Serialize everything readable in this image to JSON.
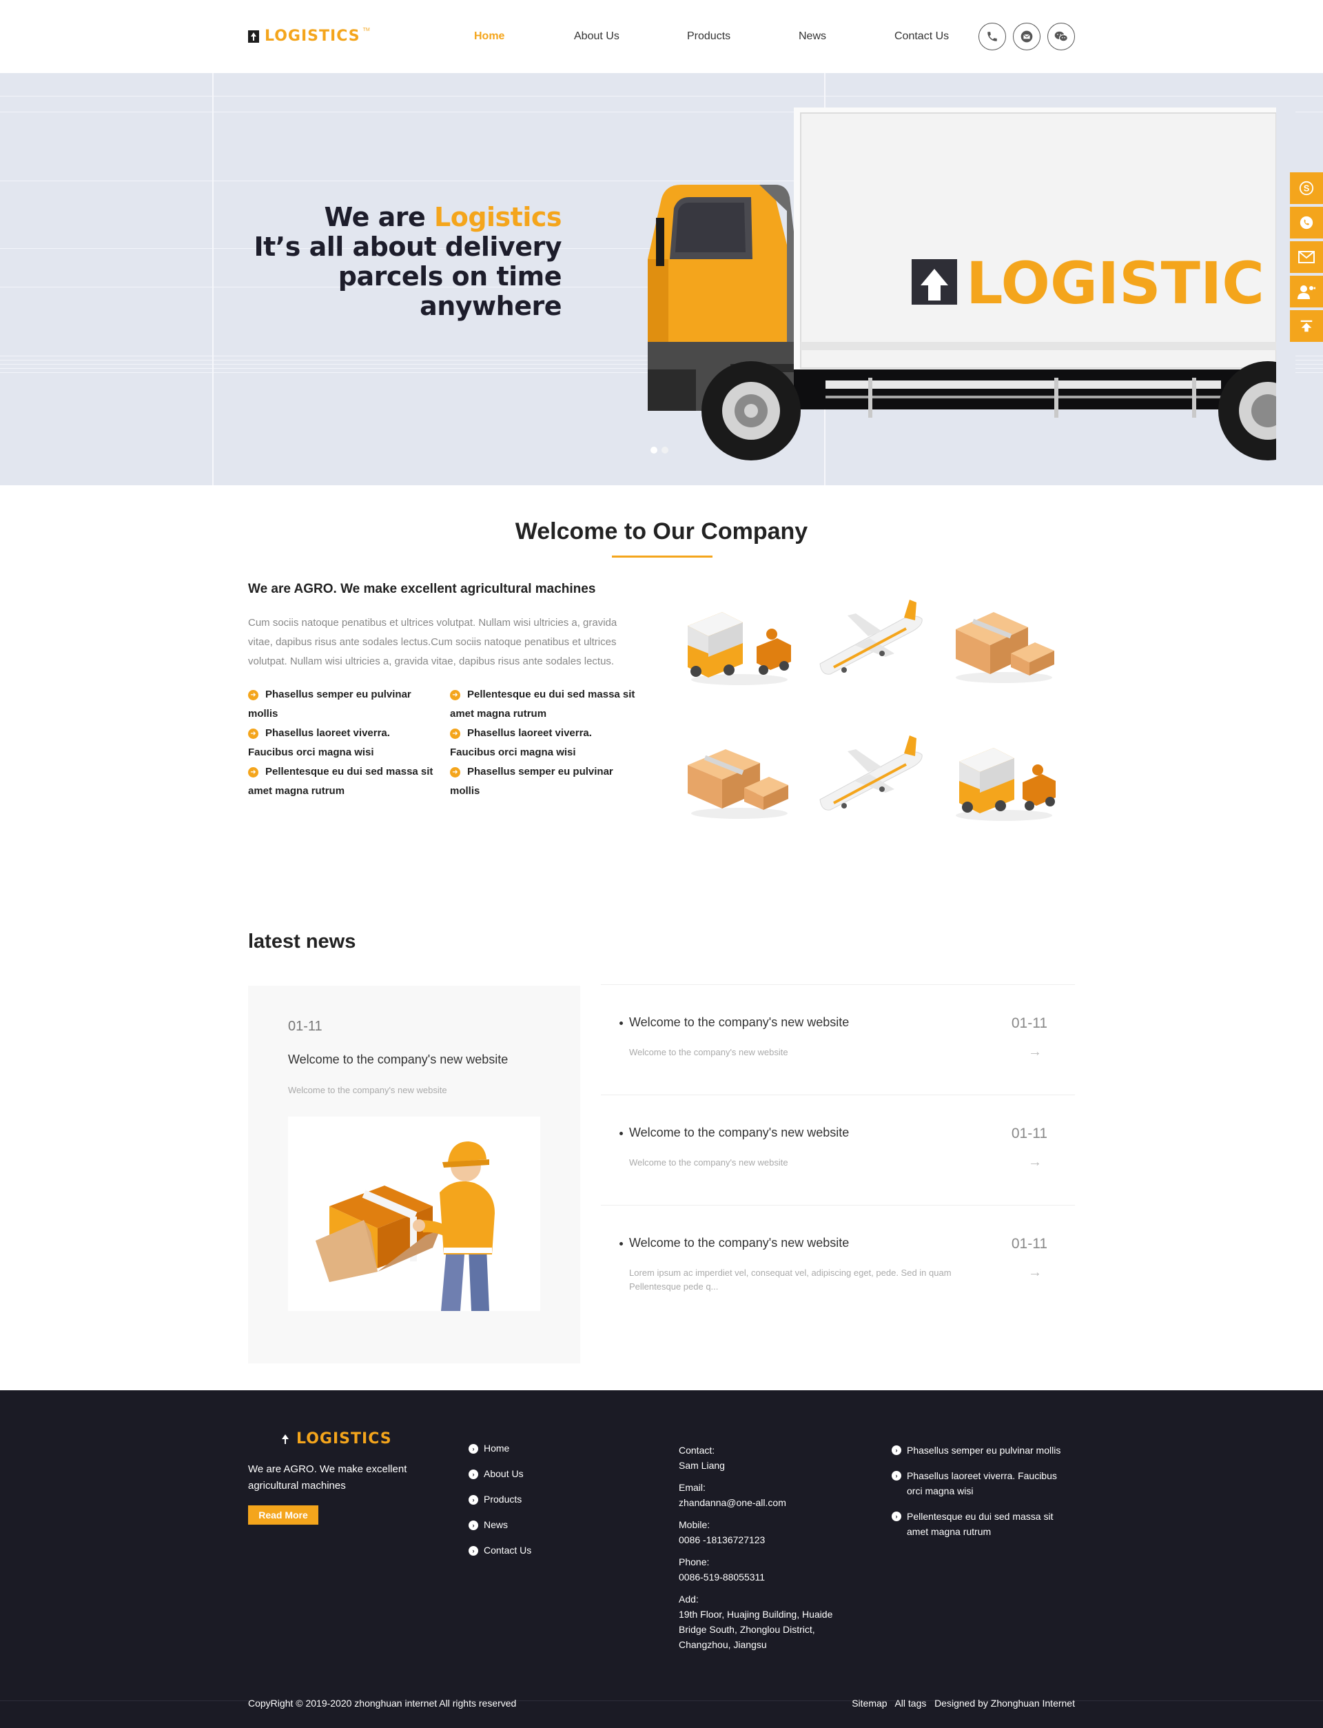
{
  "header": {
    "logo_text": "LOGISTICS",
    "logo_tm": "TM",
    "nav": [
      "Home",
      "About Us",
      "Products",
      "News",
      "Contact Us"
    ],
    "icons": [
      "phone-icon",
      "mail-icon",
      "wechat-icon"
    ]
  },
  "hero": {
    "line1_prefix": "We are",
    "line1_highlight": "Logistics",
    "line2": "It’s all about delivery",
    "line3": "parcels on time",
    "line4": "anywhere",
    "truck_label": "LOGISTIC",
    "slide_count": 2,
    "active_slide": 1
  },
  "side_bar": [
    "skype-icon",
    "whatsapp-icon",
    "email-icon",
    "user-icon",
    "top-icon"
  ],
  "welcome": {
    "title": "Welcome to Our Company",
    "subtitle": "We are AGRO. We make excellent agricultural machines",
    "paragraph": "Cum sociis natoque penatibus et ultrices volutpat. Nullam wisi ultricies a, gravida vitae, dapibus risus ante sodales lectus.Cum sociis natoque penatibus et ultrices volutpat. Nullam wisi ultricies a, gravida vitae, dapibus risus ante sodales lectus.",
    "features_left": [
      "Phasellus semper eu pulvinar mollis",
      "Phasellus laoreet viverra. Faucibus orci magna wisi",
      "Pellentesque eu dui sed massa sit amet magna rutrum"
    ],
    "features_right": [
      "Pellentesque eu dui sed massa sit amet magna rutrum",
      "Phasellus laoreet viverra. Faucibus orci magna wisi",
      "Phasellus semper eu pulvinar mollis"
    ]
  },
  "news": {
    "heading": "latest news",
    "featured": {
      "date": "01-11",
      "title": "Welcome to the company's new website",
      "desc": "Welcome to the company's new website"
    },
    "items": [
      {
        "title": "Welcome to the company's new website",
        "date": "01-11",
        "desc": "Welcome to the company's new website"
      },
      {
        "title": "Welcome to the company's new website",
        "date": "01-11",
        "desc": "Welcome to the company's new website"
      },
      {
        "title": "Welcome to the company's new website",
        "date": "01-11",
        "desc": "Lorem ipsum ac imperdiet vel, consequat vel, adipiscing eget, pede. Sed in quam Pellentesque pede q..."
      }
    ],
    "arrow": "→"
  },
  "footer": {
    "logo_text": "LOGISTICS",
    "tagline": "We are AGRO. We make excellent agricultural machines",
    "read_more": "Read More",
    "links": [
      "Home",
      "About Us",
      "Products",
      "News",
      "Contact Us"
    ],
    "contact": {
      "contact_label": "Contact:",
      "contact_value": "Sam Liang",
      "email_label": "Email:",
      "email_value": "zhandanna@one-all.com",
      "mobile_label": "Mobile:",
      "mobile_value": "0086 -18136727123",
      "phone_label": "Phone:",
      "phone_value": "0086-519-88055311",
      "add_label": "Add:",
      "add_value": "19th Floor, Huajing Building, Huaide Bridge South, Zhonglou District, Changzhou, Jiangsu"
    },
    "list": [
      "Phasellus semper eu pulvinar mollis",
      "Phasellus laoreet viverra. Faucibus orci magna wisi",
      "Pellentesque eu dui sed massa sit amet magna rutrum"
    ],
    "copyright": "CopyRight © 2019-2020   zhonghuan internet  All rights reserved",
    "bottom_links": [
      "Sitemap",
      "All tags",
      "Designed by Zhonghuan Internet"
    ]
  },
  "colors": {
    "accent": "#f4a51c",
    "footer_bg": "#1b1b25",
    "hero_bg": "#e2e6ef"
  }
}
